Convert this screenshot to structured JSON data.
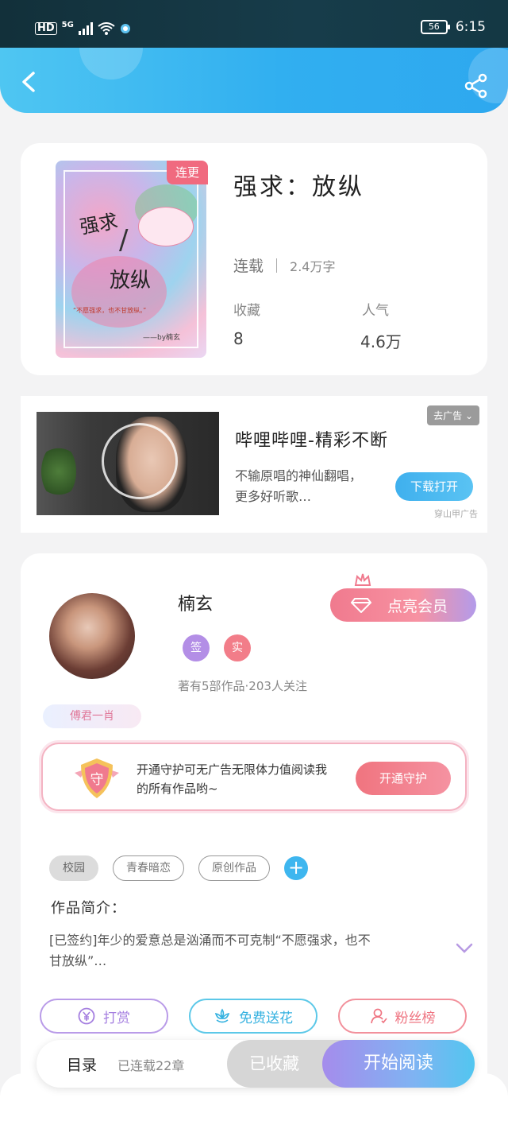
{
  "status_bar": {
    "network_hd": "HD",
    "network_gen": "5G",
    "battery": "56",
    "time": "6:15"
  },
  "book": {
    "title": "强求：放纵",
    "badge": "连更",
    "cover_text": {
      "title1": "强求",
      "slash": "/",
      "title2": "放纵",
      "quote": "“不愿强求，也不甘放纵。”",
      "signature": "——by楠玄"
    },
    "status": "连载",
    "word_count": "2.4万字",
    "collect_label": "收藏",
    "collect_value": "8",
    "popularity_label": "人气",
    "popularity_value": "4.6万"
  },
  "ad": {
    "remove_label": "去广告 ⌄",
    "title": "哔哩哔哩-精彩不断",
    "description": "不输原唱的神仙翻唱，更多好听歌…",
    "button": "下载打开",
    "source": "穿山甲广告"
  },
  "author": {
    "name": "楠玄",
    "tag_signed": "签",
    "tag_verified": "实",
    "stats": "著有5部作品·203人关注",
    "vip_button": "点亮会员",
    "fan_badge": "傅君一肖",
    "guard_text": "开通守护可无广告无限体力值阅读我的所有作品哟~",
    "guard_icon_char": "守",
    "guard_button": "开通守护"
  },
  "tags": [
    "校园",
    "青春暗恋",
    "原创作品"
  ],
  "add_tag": "+",
  "intro": {
    "heading": "作品简介：",
    "text": "[已签约]年少的爱意总是汹涌而不可克制“不愿强求，也不甘放纵”…"
  },
  "actions": {
    "reward": "打赏",
    "flowers": "免费送花",
    "fans": "粉丝榜"
  },
  "bottom": {
    "toc": "目录",
    "chapters": "已连载22章",
    "collected": "已收藏",
    "read": "开始阅读"
  },
  "colors": {
    "accent_blue": "#31aff0",
    "pink": "#f06a7f",
    "purple": "#a58cec"
  }
}
